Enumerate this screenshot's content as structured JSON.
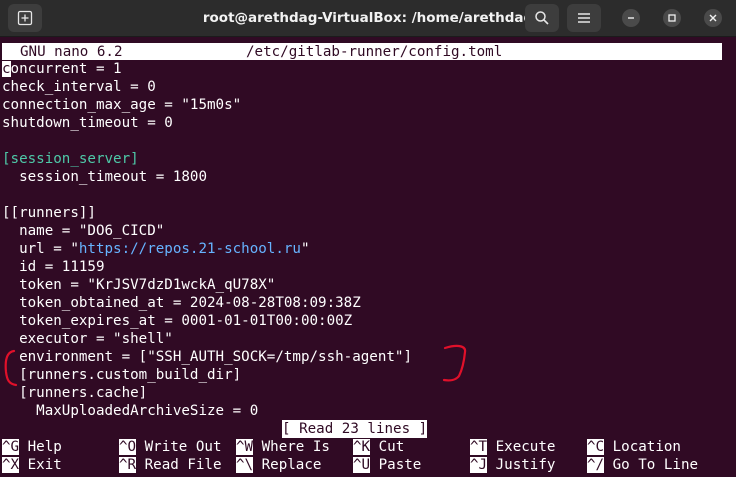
{
  "window": {
    "title": "root@arethdag-VirtualBox: /home/arethdag"
  },
  "nano": {
    "version": "GNU nano 6.2",
    "filename": "/etc/gitlab-runner/config.toml",
    "status_message": "[ Read 23 lines ]"
  },
  "file_lines": [
    "concurrent = 1",
    "check_interval = 0",
    "connection_max_age = \"15m0s\"",
    "shutdown_timeout = 0",
    "",
    "[session_server]",
    "  session_timeout = 1800",
    "",
    "[[runners]]",
    "  name = \"DO6_CICD\"",
    "  url = \"https://repos.21-school.ru\"",
    "  id = 11159",
    "  token = \"KrJSV7dzD1wckA_qU78X\"",
    "  token_obtained_at = 2024-08-28T08:09:38Z",
    "  token_expires_at = 0001-01-01T00:00:00Z",
    "  executor = \"shell\"",
    "  environment = [\"SSH_AUTH_SOCK=/tmp/ssh-agent\"]",
    "  [runners.custom_build_dir]",
    "  [runners.cache]",
    "    MaxUploadedArchiveSize = 0"
  ],
  "url_parts": {
    "prefix": "  url = \"",
    "link": "https://repos.21-school.ru",
    "suffix": "\""
  },
  "first_char": "c",
  "first_rest": "oncurrent = 1",
  "shortcuts_row1": [
    {
      "key": "^G",
      "label": " Help"
    },
    {
      "key": "^O",
      "label": " Write Out"
    },
    {
      "key": "^W",
      "label": " Where Is"
    },
    {
      "key": "^K",
      "label": " Cut"
    },
    {
      "key": "^T",
      "label": " Execute"
    },
    {
      "key": "^C",
      "label": " Location"
    }
  ],
  "shortcuts_row2": [
    {
      "key": "^X",
      "label": " Exit"
    },
    {
      "key": "^R",
      "label": " Read File"
    },
    {
      "key": "^\\",
      "label": " Replace"
    },
    {
      "key": "^U",
      "label": " Paste"
    },
    {
      "key": "^J",
      "label": " Justify"
    },
    {
      "key": "^/",
      "label": " Go To Line"
    }
  ],
  "colors": {
    "background": "#300a24",
    "section_header": "#4ec9a8",
    "url": "#66b3ff",
    "annotation": "#e0102a"
  },
  "icons": [
    "new-tab-icon",
    "search-icon",
    "hamburger-menu-icon",
    "minimize-icon",
    "maximize-icon",
    "close-icon"
  ]
}
